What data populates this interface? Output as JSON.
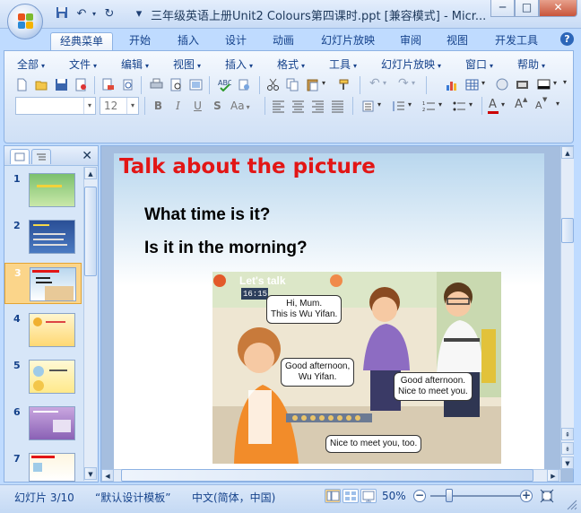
{
  "window": {
    "title": "三年级英语上册Unit2 Colours第四课时.ppt [兼容模式] - Micr...",
    "minimize": "─",
    "maximize": "□",
    "close": "✕"
  },
  "quick_access": {
    "dropdown": "▾"
  },
  "tabs": [
    {
      "label": "经典菜单"
    },
    {
      "label": "开始"
    },
    {
      "label": "插入"
    },
    {
      "label": "设计"
    },
    {
      "label": "动画"
    },
    {
      "label": "幻灯片放映"
    },
    {
      "label": "审阅"
    },
    {
      "label": "视图"
    },
    {
      "label": "开发工具"
    }
  ],
  "help": "?",
  "menu": [
    {
      "label": "全部"
    },
    {
      "label": "文件"
    },
    {
      "label": "编辑"
    },
    {
      "label": "视图"
    },
    {
      "label": "插入"
    },
    {
      "label": "格式"
    },
    {
      "label": "工具"
    },
    {
      "label": "幻灯片放映"
    },
    {
      "label": "窗口"
    },
    {
      "label": "帮助"
    }
  ],
  "format_bar": {
    "font_name": "",
    "font_size": "12",
    "bold": "B",
    "italic": "I",
    "underline": "U",
    "strike": "S",
    "case": "Aa",
    "font_color": "A",
    "grow": "A",
    "shrink": "A"
  },
  "slides": [
    {
      "num": "1"
    },
    {
      "num": "2"
    },
    {
      "num": "3"
    },
    {
      "num": "4"
    },
    {
      "num": "5"
    },
    {
      "num": "6"
    },
    {
      "num": "7"
    }
  ],
  "slide": {
    "title": "Talk about the picture",
    "question1": "What time is it?",
    "question2": "Is it in the morning?",
    "lets_talk": "Let's talk",
    "clock": "16:15",
    "bubbles": [
      {
        "l1": "Hi, Mum.",
        "l2": "This is Wu Yifan."
      },
      {
        "l1": "Good afternoon,",
        "l2": "Wu Yifan."
      },
      {
        "l1": "Good afternoon.",
        "l2": "Nice to meet you."
      },
      {
        "l1": "Nice to meet you, too.",
        "l2": ""
      }
    ]
  },
  "status": {
    "slide_info": "幻灯片 3/10",
    "theme": "“默认设计模板”",
    "language": "中文(简体，中国)",
    "zoom": "50%",
    "zoom_value_percent": 50,
    "zoom_minus": "−",
    "zoom_plus": "+"
  },
  "colors": {
    "title_red": "#e21616",
    "ribbon_blue": "#bfdbff",
    "selected_slide": "#fbd58a"
  }
}
